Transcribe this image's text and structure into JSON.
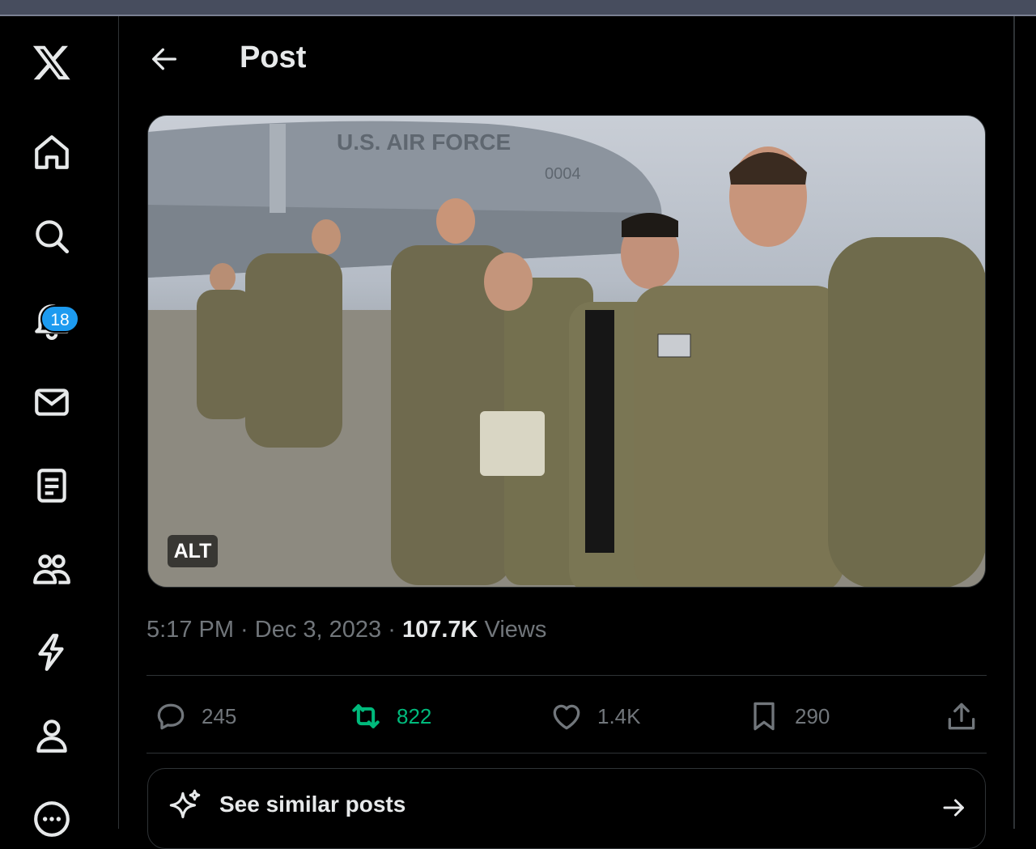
{
  "sidebar": {
    "notifications_badge": "18",
    "items": [
      "x-logo",
      "home-icon",
      "search-icon",
      "bell-icon",
      "mail-icon",
      "lists-icon",
      "communities-icon",
      "premium-icon",
      "profile-icon",
      "more-icon"
    ]
  },
  "header": {
    "title": "Post"
  },
  "media": {
    "alt_label": "ALT",
    "aircraft_text": "U.S. AIR FORCE",
    "tail_number": "0004"
  },
  "meta": {
    "time": "5:17 PM",
    "separator": " · ",
    "date": "Dec 3, 2023",
    "views_count": "107.7K",
    "views_label": "Views"
  },
  "actions": {
    "replies": "245",
    "reposts": "822",
    "likes": "1.4K",
    "bookmarks": "290"
  },
  "similar": {
    "label": "See similar posts"
  },
  "colors": {
    "accent": "#1d9bf0",
    "repost_green": "#00ba7c",
    "muted": "#71767b",
    "text": "#e7e9ea",
    "border": "#2f3336"
  }
}
